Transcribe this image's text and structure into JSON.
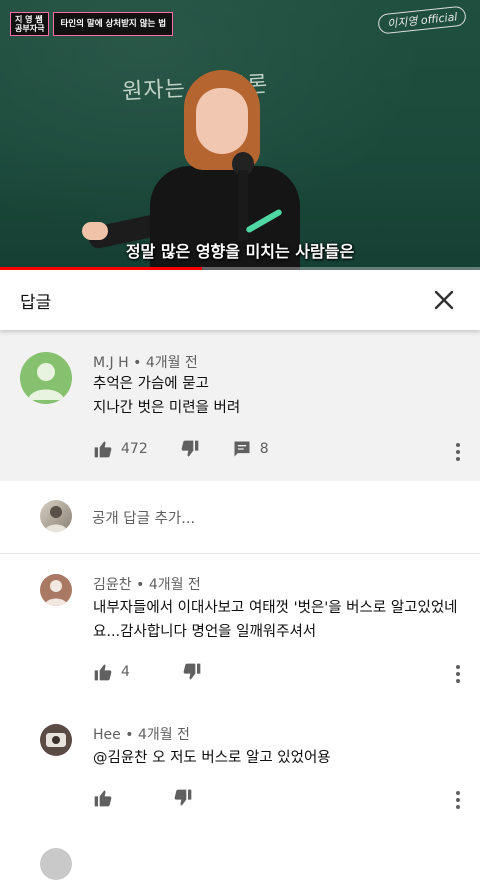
{
  "video": {
    "badge_line1": "지 영 쌤",
    "badge_line2": "공부자극",
    "title_badge": "타인의 말에 상처받지 않는 법",
    "channel_logo": "이지영 official",
    "board_text": "원자는 ... 물론",
    "subtitle": "정말 많은 영향을 미치는 사람들은",
    "progress_percent": 42,
    "accent_color": "#ff0000"
  },
  "header": {
    "title": "답글",
    "close_icon": "close-icon"
  },
  "main_comment": {
    "author": "M.J H",
    "time": "4개월 전",
    "line1": "추억은 가슴에 묻고",
    "line2": "지나간 벗은 미련을 버려",
    "likes": "472",
    "replies": "8"
  },
  "add_reply": {
    "placeholder": "공개 답글 추가..."
  },
  "replies": [
    {
      "author": "김윤찬",
      "time": "4개월 전",
      "line1": "내부자들에서 이대사보고 여태껏 '벗은'을 버스로 알고있었네",
      "line2": "요...감사합니다 명언을 일깨워주셔서",
      "likes": "4"
    },
    {
      "author": "Hee",
      "time": "4개월 전",
      "line1": "@김윤찬 오 저도 버스로 알고 있었어용",
      "likes": ""
    }
  ]
}
